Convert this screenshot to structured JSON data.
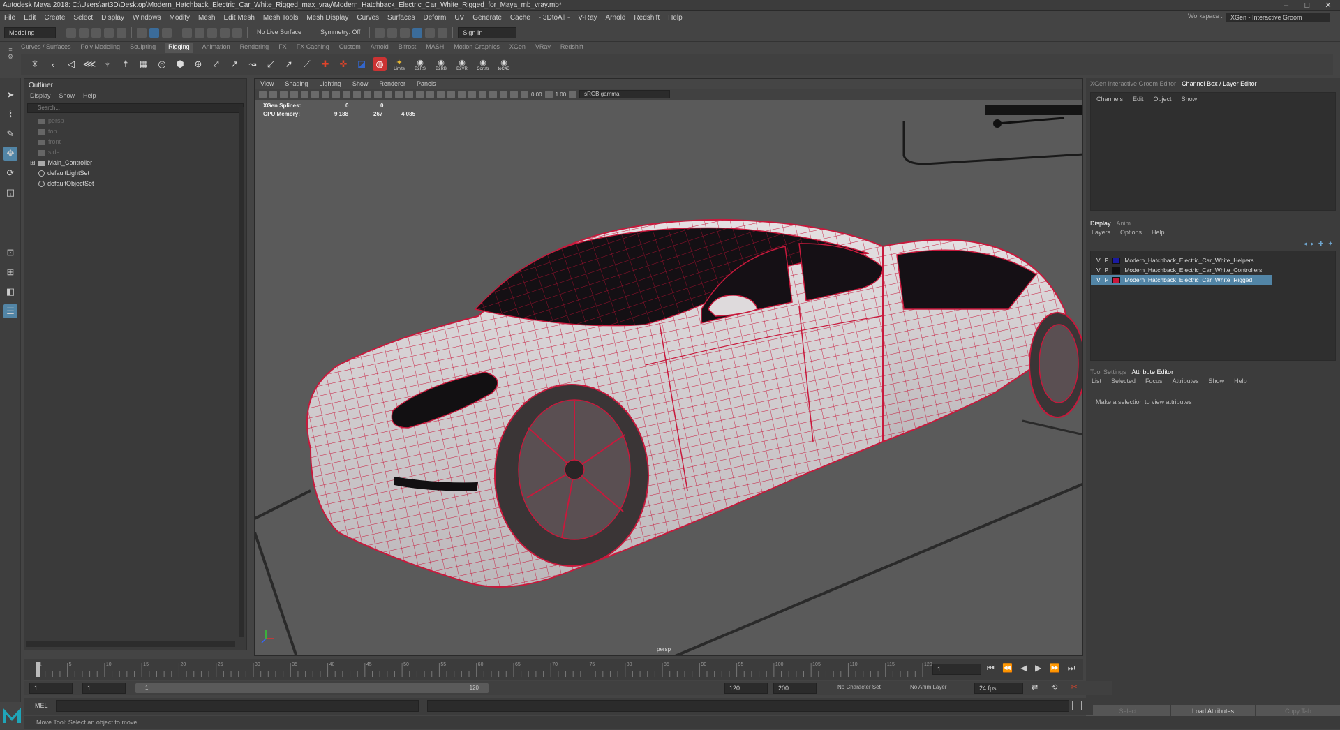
{
  "window": {
    "title": "Autodesk Maya 2018: C:\\Users\\art3D\\Desktop\\Modern_Hatchback_Electric_Car_White_Rigged_max_vray\\Modern_Hatchback_Electric_Car_White_Rigged_for_Maya_mb_vray.mb*",
    "minimize": "–",
    "maximize": "□",
    "close": "✕"
  },
  "menubar": [
    "File",
    "Edit",
    "Create",
    "Select",
    "Display",
    "Windows",
    "Modify",
    "Mesh",
    "Edit Mesh",
    "Mesh Tools",
    "Mesh Display",
    "Curves",
    "Surfaces",
    "Deform",
    "UV",
    "Generate",
    "Cache",
    "- 3DtoAll -",
    "V-Ray",
    "Arnold",
    "Redshift",
    "Help"
  ],
  "workspace": {
    "label": "Workspace :",
    "value": "XGen - Interactive Groom"
  },
  "statusline": {
    "mode": "Modeling",
    "live_surface": "No Live Surface",
    "symmetry": "Symmetry: Off",
    "sign_in": "Sign In"
  },
  "shelf": {
    "tabs": [
      "Curves / Surfaces",
      "Poly Modeling",
      "Sculpting",
      "Rigging",
      "Animation",
      "Rendering",
      "FX",
      "FX Caching",
      "Custom",
      "Arnold",
      "Bifrost",
      "MASH",
      "Motion Graphics",
      "XGen",
      "VRay",
      "Redshift"
    ],
    "active_tab": "Rigging",
    "small_labels": [
      "Limits",
      "B2RS",
      "B2RB",
      "B2VR",
      "Constr",
      "toC4D"
    ]
  },
  "outliner": {
    "title": "Outliner",
    "menu": [
      "Display",
      "Show",
      "Help"
    ],
    "search_placeholder": "Search...",
    "items": [
      {
        "label": "persp",
        "dim": true
      },
      {
        "label": "top",
        "dim": true
      },
      {
        "label": "front",
        "dim": true
      },
      {
        "label": "side",
        "dim": true
      },
      {
        "label": "Main_Controller",
        "dim": false
      },
      {
        "label": "defaultLightSet",
        "dim": false
      },
      {
        "label": "defaultObjectSet",
        "dim": false
      }
    ]
  },
  "viewport": {
    "menu": [
      "View",
      "Shading",
      "Lighting",
      "Show",
      "Renderer",
      "Panels"
    ],
    "exposure": "0.00",
    "gamma": "1.00",
    "color_space": "sRGB gamma",
    "hud_xgen_label": "XGen Splines:",
    "hud_xgen_values": [
      "0",
      "0"
    ],
    "hud_gpu_label": "GPU Memory:",
    "hud_gpu_values": [
      "9 188",
      "267",
      "4 085"
    ],
    "camera": "persp"
  },
  "right_panel": {
    "top_tabs": [
      "XGen Interactive Groom Editor",
      "Channel Box / Layer Editor"
    ],
    "active_top_tab": "Channel Box / Layer Editor",
    "channel_menu": [
      "Channels",
      "Edit",
      "Object",
      "Show"
    ],
    "layer_tabs": [
      "Display",
      "Anim"
    ],
    "layer_menu": [
      "Layers",
      "Options",
      "Help"
    ],
    "layers": [
      {
        "v": "V",
        "p": "P",
        "color": "#1a1aa0",
        "name": "Modern_Hatchback_Electric_Car_White_Helpers",
        "selected": false
      },
      {
        "v": "V",
        "p": "P",
        "color": "#111111",
        "name": "Modern_Hatchback_Electric_Car_White_Controllers",
        "selected": false
      },
      {
        "v": "V",
        "p": "P",
        "color": "#c8193c",
        "name": "Modern_Hatchback_Electric_Car_White_Rigged",
        "selected": true
      }
    ],
    "attr_tabs": [
      "Tool Settings",
      "Attribute Editor"
    ],
    "active_attr_tab": "Attribute Editor",
    "attr_menu": [
      "List",
      "Selected",
      "Focus",
      "Attributes",
      "Show",
      "Help"
    ],
    "attr_message": "Make a selection to view attributes",
    "bottom_buttons": [
      "Select",
      "Load Attributes",
      "Copy Tab"
    ]
  },
  "timeline": {
    "ticks": [
      "1",
      "5",
      "10",
      "15",
      "20",
      "25",
      "30",
      "35",
      "40",
      "45",
      "50",
      "55",
      "60",
      "65",
      "70",
      "75",
      "80",
      "85",
      "90",
      "95",
      "100",
      "105",
      "110",
      "115",
      "120"
    ],
    "current_frame": "1"
  },
  "range": {
    "start": "1",
    "start2": "1",
    "slider_start": "1",
    "slider_end": "120",
    "end": "120",
    "end2": "200",
    "character_set": "No Character Set",
    "anim_layer": "No Anim Layer",
    "fps": "24 fps"
  },
  "command": {
    "label": "MEL"
  },
  "help_line": "Move Tool: Select an object to move.",
  "colors": {
    "accent": "#5285a6",
    "wire": "#c8193c",
    "viewport_bg": "#5a5a5a"
  }
}
